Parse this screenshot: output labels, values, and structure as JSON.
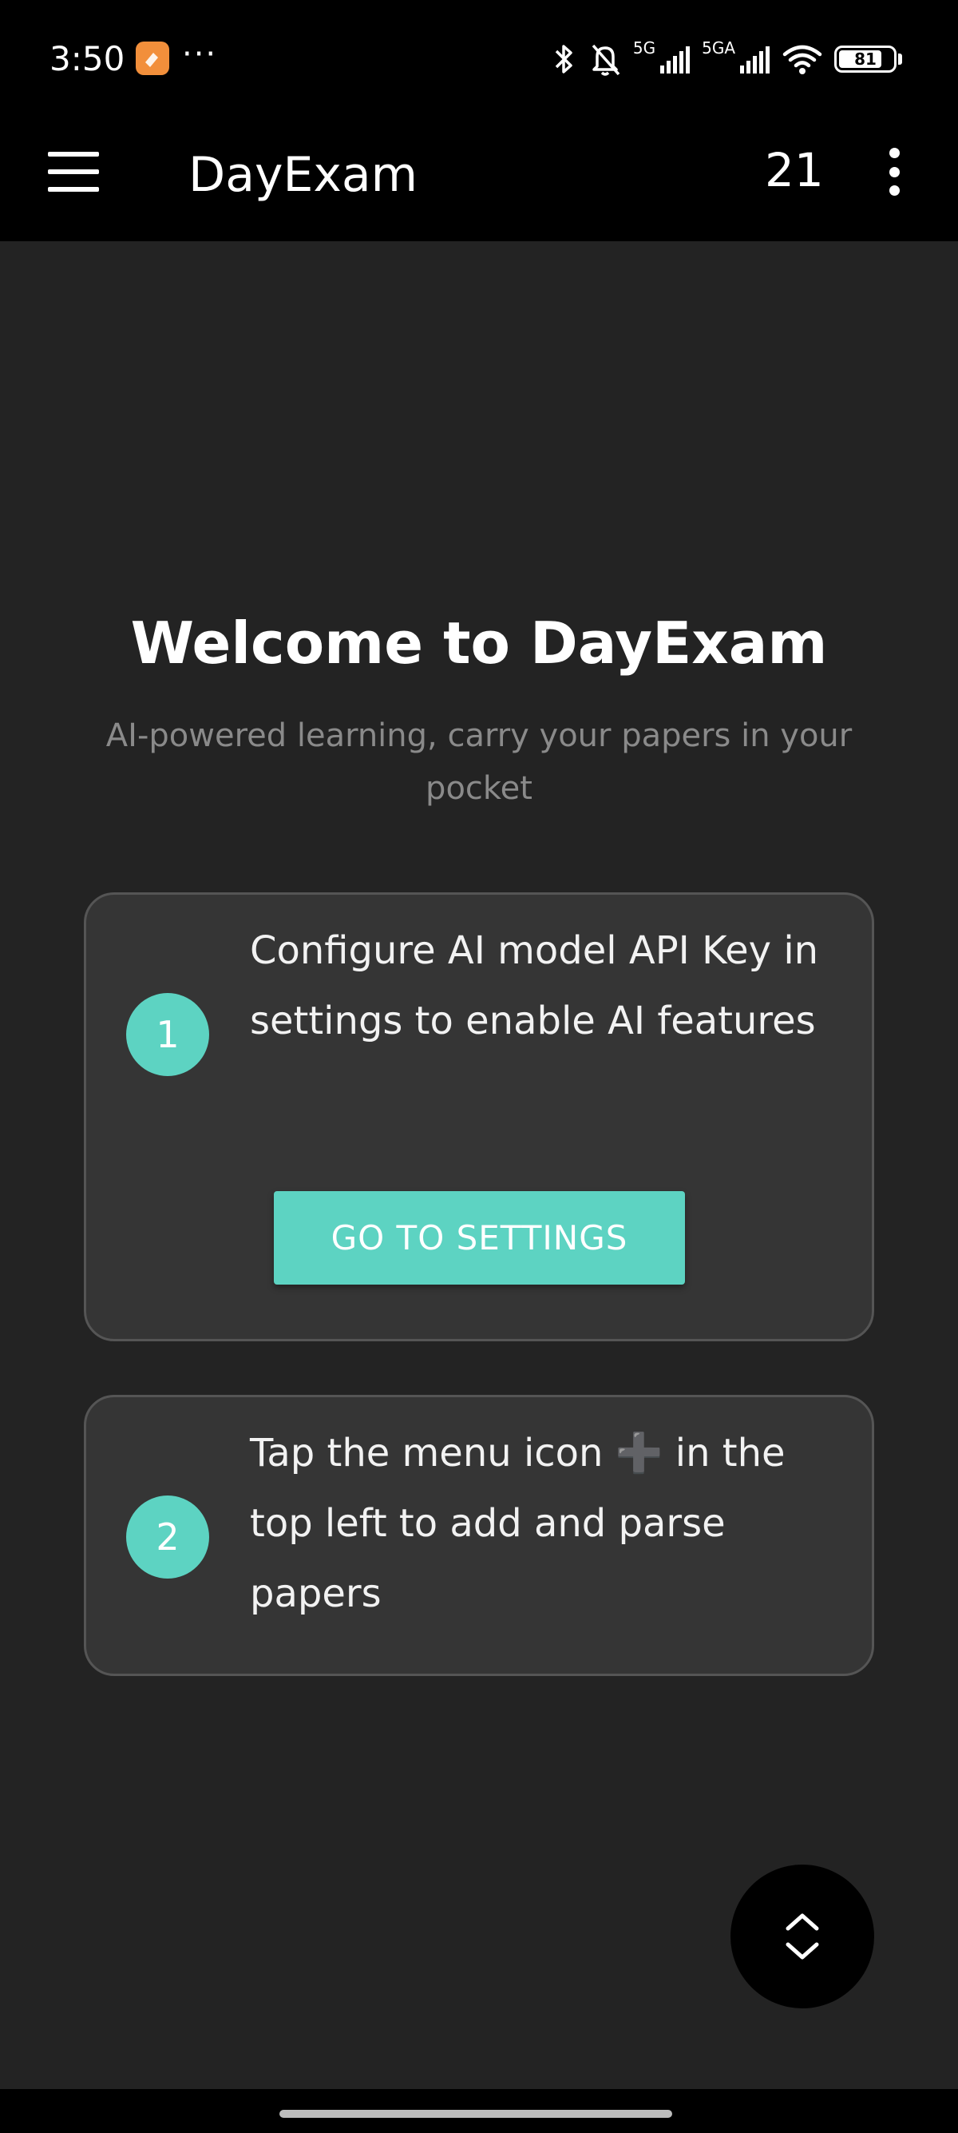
{
  "status_bar": {
    "time": "3:50",
    "more": "···",
    "network_1": "5G",
    "network_2": "5GA",
    "battery_level": "81",
    "battery_fraction": 0.81,
    "app_icon_color": "#f28f3b",
    "icons": [
      "bluetooth-icon",
      "bell-off-icon",
      "signal-icon",
      "signal-icon",
      "wifi-icon",
      "battery-icon"
    ]
  },
  "app_bar": {
    "title": "DayExam",
    "count": "21",
    "menu_icon": "hamburger-menu-icon",
    "overflow_icon": "more-vertical-icon"
  },
  "welcome": {
    "title": "Welcome to DayExam",
    "subtitle": "AI-powered learning, carry your papers in your pocket"
  },
  "steps": [
    {
      "number": "1",
      "text": "Configure AI model API Key in settings to enable AI features",
      "button_label": "GO TO SETTINGS"
    },
    {
      "number": "2",
      "text": "Tap the menu icon ➕ in the top left to add and parse papers"
    }
  ],
  "fab": {
    "icon": "scroll-up-down-icon"
  },
  "colors": {
    "accent": "#5dd3c2",
    "background": "#232323",
    "card": "#353535",
    "card_border": "#555555",
    "bar": "#000000",
    "subtitle_text": "#8a8a8a"
  }
}
